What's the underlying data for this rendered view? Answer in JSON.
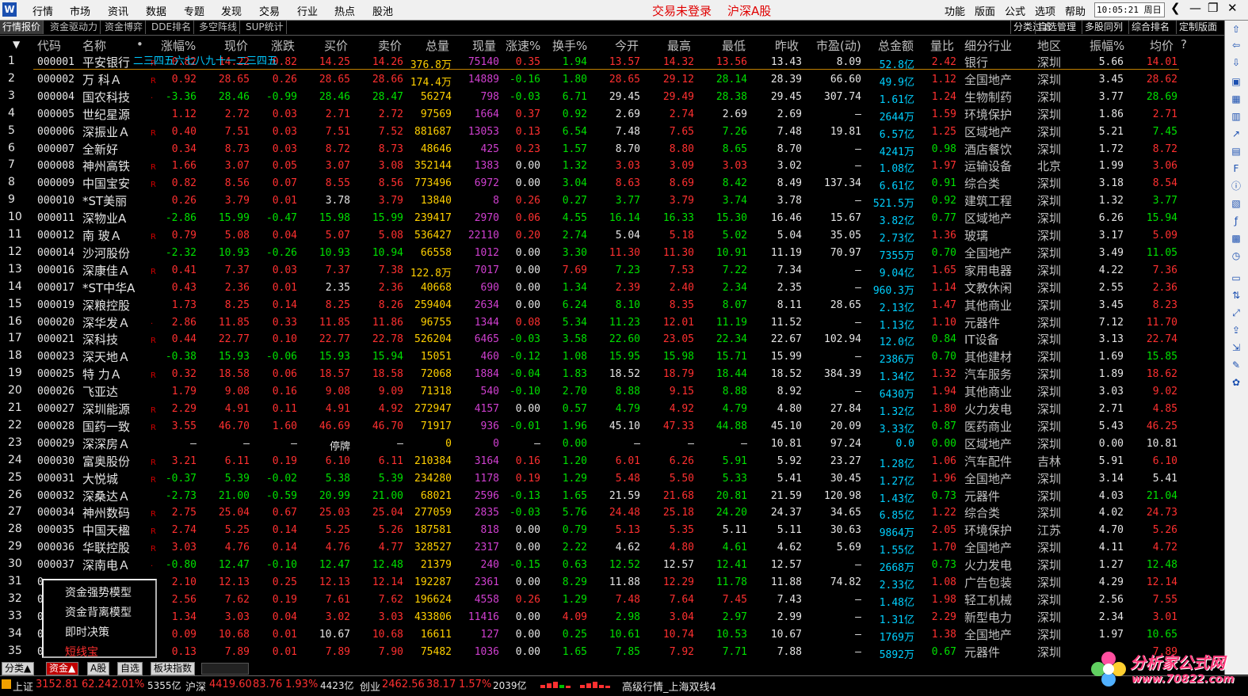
{
  "menubar": {
    "items": [
      "行情",
      "市场",
      "资讯",
      "数据",
      "专题",
      "发现",
      "交易",
      "行业",
      "热点",
      "股池"
    ],
    "status": [
      "交易未登录",
      "沪深A股"
    ],
    "right_items": [
      "功能",
      "版面",
      "公式",
      "选项",
      "帮助"
    ],
    "clock": "10:05:21 周日"
  },
  "tabs": {
    "left": [
      "行情报价",
      "资金驱动力",
      "资金博弈",
      "DDE排名",
      "多空阵线",
      "SUP统计"
    ],
    "right": [
      "分类过滤",
      "自选管理",
      "多股同列",
      "综合排名",
      "定制版面"
    ]
  },
  "table": {
    "headers": [
      "代码",
      "名称",
      "•",
      "涨幅%",
      "现价",
      "涨跌",
      "买价",
      "卖价",
      "总量",
      "现量",
      "涨速%",
      "换手%",
      "今开",
      "最高",
      "最低",
      "昨收",
      "市盈(动)",
      "总金额",
      "量比",
      "细分行业",
      "地区",
      "振幅%",
      "均价",
      "?"
    ],
    "overlay_text": "二三四五六七八九十一二三四五",
    "rows": [
      [
        "1",
        "000001",
        "平安银行",
        "R",
        "0.82",
        "14.22",
        "0.82",
        "14.25",
        "14.26",
        "376.8万",
        "75140",
        "0.35",
        "1.94",
        "13.57",
        "14.32",
        "13.56",
        "13.43",
        "8.09",
        "52.8亿",
        "2.42",
        "银行",
        "深圳",
        "5.66",
        "14.01"
      ],
      [
        "2",
        "000002",
        "万 科Ａ",
        "R",
        "0.92",
        "28.65",
        "0.26",
        "28.65",
        "28.66",
        "174.4万",
        "14889",
        "-0.16",
        "1.80",
        "28.65",
        "29.12",
        "28.14",
        "28.39",
        "66.60",
        "49.9亿",
        "1.12",
        "全国地产",
        "深圳",
        "3.45",
        "28.62"
      ],
      [
        "3",
        "000004",
        "国农科技",
        "·",
        "-3.36",
        "28.46",
        "-0.99",
        "28.46",
        "28.47",
        "56274",
        "798",
        "-0.03",
        "6.71",
        "29.45",
        "29.49",
        "28.38",
        "29.45",
        "307.74",
        "1.61亿",
        "1.24",
        "生物制药",
        "深圳",
        "3.77",
        "28.69"
      ],
      [
        "4",
        "000005",
        "世纪星源",
        "",
        "1.12",
        "2.72",
        "0.03",
        "2.71",
        "2.72",
        "97569",
        "1664",
        "0.37",
        "0.92",
        "2.69",
        "2.74",
        "2.69",
        "2.69",
        "—",
        "2644万",
        "1.59",
        "环境保护",
        "深圳",
        "1.86",
        "2.71"
      ],
      [
        "5",
        "000006",
        "深振业Ａ",
        "R",
        "0.40",
        "7.51",
        "0.03",
        "7.51",
        "7.52",
        "881687",
        "13053",
        "0.13",
        "6.54",
        "7.48",
        "7.65",
        "7.26",
        "7.48",
        "19.81",
        "6.57亿",
        "1.25",
        "区域地产",
        "深圳",
        "5.21",
        "7.45"
      ],
      [
        "6",
        "000007",
        "全新好",
        "",
        "0.34",
        "8.73",
        "0.03",
        "8.72",
        "8.73",
        "48646",
        "425",
        "0.23",
        "1.57",
        "8.70",
        "8.80",
        "8.65",
        "8.70",
        "—",
        "4241万",
        "0.98",
        "酒店餐饮",
        "深圳",
        "1.72",
        "8.72"
      ],
      [
        "7",
        "000008",
        "神州高铁",
        "R",
        "1.66",
        "3.07",
        "0.05",
        "3.07",
        "3.08",
        "352144",
        "1383",
        "0.00",
        "1.32",
        "3.03",
        "3.09",
        "3.03",
        "3.02",
        "—",
        "1.08亿",
        "1.97",
        "运输设备",
        "北京",
        "1.99",
        "3.06"
      ],
      [
        "8",
        "000009",
        "中国宝安",
        "R",
        "0.82",
        "8.56",
        "0.07",
        "8.55",
        "8.56",
        "773496",
        "6972",
        "0.00",
        "3.04",
        "8.63",
        "8.69",
        "8.42",
        "8.49",
        "137.34",
        "6.61亿",
        "0.91",
        "综合类",
        "深圳",
        "3.18",
        "8.54"
      ],
      [
        "9",
        "000010",
        "*ST美丽",
        "",
        "0.26",
        "3.79",
        "0.01",
        "3.78",
        "3.79",
        "13840",
        "8",
        "0.26",
        "0.27",
        "3.77",
        "3.79",
        "3.74",
        "3.78",
        "—",
        "521.5万",
        "0.92",
        "建筑工程",
        "深圳",
        "1.32",
        "3.77"
      ],
      [
        "10",
        "000011",
        "深物业A",
        "",
        "-2.86",
        "15.99",
        "-0.47",
        "15.98",
        "15.99",
        "239417",
        "2970",
        "0.06",
        "4.55",
        "16.14",
        "16.33",
        "15.30",
        "16.46",
        "15.67",
        "3.82亿",
        "0.77",
        "区域地产",
        "深圳",
        "6.26",
        "15.94"
      ],
      [
        "11",
        "000012",
        "南 玻Ａ",
        "R",
        "0.79",
        "5.08",
        "0.04",
        "5.07",
        "5.08",
        "536427",
        "22110",
        "0.20",
        "2.74",
        "5.04",
        "5.18",
        "5.02",
        "5.04",
        "35.05",
        "2.73亿",
        "1.36",
        "玻璃",
        "深圳",
        "3.17",
        "5.09"
      ],
      [
        "12",
        "000014",
        "沙河股份",
        "",
        "-2.32",
        "10.93",
        "-0.26",
        "10.93",
        "10.94",
        "66558",
        "1012",
        "0.00",
        "3.30",
        "11.30",
        "11.30",
        "10.91",
        "11.19",
        "70.97",
        "7355万",
        "0.70",
        "全国地产",
        "深圳",
        "3.49",
        "11.05"
      ],
      [
        "13",
        "000016",
        "深康佳Ａ",
        "R",
        "0.41",
        "7.37",
        "0.03",
        "7.37",
        "7.38",
        "122.8万",
        "7017",
        "0.00",
        "7.69",
        "7.23",
        "7.53",
        "7.22",
        "7.34",
        "—",
        "9.04亿",
        "1.65",
        "家用电器",
        "深圳",
        "4.22",
        "7.36"
      ],
      [
        "14",
        "000017",
        "*ST中华A",
        "",
        "0.43",
        "2.36",
        "0.01",
        "2.35",
        "2.36",
        "40668",
        "690",
        "0.00",
        "1.34",
        "2.39",
        "2.40",
        "2.34",
        "2.35",
        "—",
        "960.3万",
        "1.14",
        "文教休闲",
        "深圳",
        "2.55",
        "2.36"
      ],
      [
        "15",
        "000019",
        "深粮控股",
        "",
        "1.73",
        "8.25",
        "0.14",
        "8.25",
        "8.26",
        "259404",
        "2634",
        "0.00",
        "6.24",
        "8.10",
        "8.35",
        "8.07",
        "8.11",
        "28.65",
        "2.13亿",
        "1.47",
        "其他商业",
        "深圳",
        "3.45",
        "8.23"
      ],
      [
        "16",
        "000020",
        "深华发Ａ",
        "·",
        "2.86",
        "11.85",
        "0.33",
        "11.85",
        "11.86",
        "96755",
        "1344",
        "0.08",
        "5.34",
        "11.23",
        "12.01",
        "11.19",
        "11.52",
        "—",
        "1.13亿",
        "1.10",
        "元器件",
        "深圳",
        "7.12",
        "11.70"
      ],
      [
        "17",
        "000021",
        "深科技",
        "R",
        "0.44",
        "22.77",
        "0.10",
        "22.77",
        "22.78",
        "526204",
        "6465",
        "-0.03",
        "3.58",
        "22.60",
        "23.05",
        "22.34",
        "22.67",
        "102.94",
        "12.0亿",
        "0.84",
        "IT设备",
        "深圳",
        "3.13",
        "22.74"
      ],
      [
        "18",
        "000023",
        "深天地Ａ",
        "",
        "-0.38",
        "15.93",
        "-0.06",
        "15.93",
        "15.94",
        "15051",
        "460",
        "-0.12",
        "1.08",
        "15.95",
        "15.98",
        "15.71",
        "15.99",
        "—",
        "2386万",
        "0.70",
        "其他建材",
        "深圳",
        "1.69",
        "15.85"
      ],
      [
        "19",
        "000025",
        "特 力Ａ",
        "R",
        "0.32",
        "18.58",
        "0.06",
        "18.57",
        "18.58",
        "72068",
        "1884",
        "-0.04",
        "1.83",
        "18.52",
        "18.79",
        "18.44",
        "18.52",
        "384.39",
        "1.34亿",
        "1.32",
        "汽车服务",
        "深圳",
        "1.89",
        "18.62"
      ],
      [
        "20",
        "000026",
        "飞亚达",
        "",
        "1.79",
        "9.08",
        "0.16",
        "9.08",
        "9.09",
        "71318",
        "540",
        "-0.10",
        "2.70",
        "8.88",
        "9.15",
        "8.88",
        "8.92",
        "—",
        "6430万",
        "1.94",
        "其他商业",
        "深圳",
        "3.03",
        "9.02"
      ],
      [
        "21",
        "000027",
        "深圳能源",
        "R",
        "2.29",
        "4.91",
        "0.11",
        "4.91",
        "4.92",
        "272947",
        "4157",
        "0.00",
        "0.57",
        "4.79",
        "4.92",
        "4.79",
        "4.80",
        "27.84",
        "1.32亿",
        "1.80",
        "火力发电",
        "深圳",
        "2.71",
        "4.85"
      ],
      [
        "22",
        "000028",
        "国药一致",
        "R",
        "3.55",
        "46.70",
        "1.60",
        "46.69",
        "46.70",
        "71917",
        "936",
        "-0.01",
        "1.96",
        "45.10",
        "47.33",
        "44.88",
        "45.10",
        "20.09",
        "3.33亿",
        "0.87",
        "医药商业",
        "深圳",
        "5.43",
        "46.25"
      ],
      [
        "23",
        "000029",
        "深深房Ａ",
        "",
        "—",
        "—",
        "—",
        "停牌",
        "—",
        "0",
        "0",
        "—",
        "0.00",
        "—",
        "—",
        "—",
        "10.81",
        "97.24",
        "0.0",
        "0.00",
        "区域地产",
        "深圳",
        "0.00",
        "10.81"
      ],
      [
        "24",
        "000030",
        "富奥股份",
        "R",
        "3.21",
        "6.11",
        "0.19",
        "6.10",
        "6.11",
        "210384",
        "3164",
        "0.16",
        "1.20",
        "6.01",
        "6.26",
        "5.91",
        "5.92",
        "23.27",
        "1.28亿",
        "1.06",
        "汽车配件",
        "吉林",
        "5.91",
        "6.10"
      ],
      [
        "25",
        "000031",
        "大悦城",
        "R",
        "-0.37",
        "5.39",
        "-0.02",
        "5.38",
        "5.39",
        "234280",
        "1178",
        "0.19",
        "1.29",
        "5.48",
        "5.50",
        "5.33",
        "5.41",
        "30.45",
        "1.27亿",
        "1.96",
        "全国地产",
        "深圳",
        "3.14",
        "5.41"
      ],
      [
        "26",
        "000032",
        "深桑达Ａ",
        "",
        "-2.73",
        "21.00",
        "-0.59",
        "20.99",
        "21.00",
        "68021",
        "2596",
        "-0.13",
        "1.65",
        "21.59",
        "21.68",
        "20.81",
        "21.59",
        "120.98",
        "1.43亿",
        "0.73",
        "元器件",
        "深圳",
        "4.03",
        "21.04"
      ],
      [
        "27",
        "000034",
        "神州数码",
        "R",
        "2.75",
        "25.04",
        "0.67",
        "25.03",
        "25.04",
        "277059",
        "2835",
        "-0.03",
        "5.76",
        "24.48",
        "25.18",
        "24.20",
        "24.37",
        "34.65",
        "6.85亿",
        "1.22",
        "综合类",
        "深圳",
        "4.02",
        "24.73"
      ],
      [
        "28",
        "000035",
        "中国天楹",
        "R",
        "2.74",
        "5.25",
        "0.14",
        "5.25",
        "5.26",
        "187581",
        "818",
        "0.00",
        "0.79",
        "5.13",
        "5.35",
        "5.11",
        "5.11",
        "30.63",
        "9864万",
        "2.05",
        "环境保护",
        "江苏",
        "4.70",
        "5.26"
      ],
      [
        "29",
        "000036",
        "华联控股",
        "R",
        "3.03",
        "4.76",
        "0.14",
        "4.76",
        "4.77",
        "328527",
        "2317",
        "0.00",
        "2.22",
        "4.62",
        "4.80",
        "4.61",
        "4.62",
        "5.69",
        "1.55亿",
        "1.70",
        "全国地产",
        "深圳",
        "4.11",
        "4.72"
      ],
      [
        "30",
        "000037",
        "深南电Ａ",
        "·",
        "-0.80",
        "12.47",
        "-0.10",
        "12.47",
        "12.48",
        "21379",
        "240",
        "-0.15",
        "0.63",
        "12.52",
        "12.57",
        "12.41",
        "12.57",
        "—",
        "2668万",
        "0.73",
        "火力发电",
        "深圳",
        "1.27",
        "12.48"
      ],
      [
        "31",
        "0",
        "",
        "R",
        "2.10",
        "12.13",
        "0.25",
        "12.13",
        "12.14",
        "192287",
        "2361",
        "0.00",
        "8.29",
        "11.88",
        "12.29",
        "11.78",
        "11.88",
        "74.82",
        "2.33亿",
        "1.08",
        "广告包装",
        "深圳",
        "4.29",
        "12.14"
      ],
      [
        "32",
        "0",
        "",
        "R",
        "2.56",
        "7.62",
        "0.19",
        "7.61",
        "7.62",
        "196624",
        "4558",
        "0.26",
        "1.29",
        "7.48",
        "7.64",
        "7.45",
        "7.43",
        "—",
        "1.48亿",
        "1.98",
        "轻工机械",
        "深圳",
        "2.56",
        "7.55"
      ],
      [
        "33",
        "0",
        "",
        "R",
        "1.34",
        "3.03",
        "0.04",
        "3.02",
        "3.03",
        "433806",
        "11416",
        "0.00",
        "4.09",
        "2.98",
        "3.04",
        "2.97",
        "2.99",
        "—",
        "1.31亿",
        "2.29",
        "新型电力",
        "深圳",
        "2.34",
        "3.01"
      ],
      [
        "34",
        "0",
        "",
        "R",
        "0.09",
        "10.68",
        "0.01",
        "10.67",
        "10.68",
        "16611",
        "127",
        "0.00",
        "0.25",
        "10.61",
        "10.74",
        "10.53",
        "10.67",
        "—",
        "1769万",
        "1.38",
        "全国地产",
        "深圳",
        "1.97",
        "10.65"
      ],
      [
        "35",
        "0",
        "",
        "R",
        "0.13",
        "7.89",
        "0.01",
        "7.89",
        "7.90",
        "75482",
        "1036",
        "0.00",
        "1.65",
        "7.85",
        "7.92",
        "7.71",
        "7.88",
        "—",
        "5892万",
        "0.67",
        "元器件",
        "深圳",
        "",
        "7.89"
      ]
    ]
  },
  "context_menu": {
    "items": [
      "资金强势模型",
      "资金背离模型",
      "即时决策",
      "短线宝"
    ]
  },
  "bottom_tabs": [
    "分类▲",
    "资金▲",
    "A股",
    "自选",
    "板块指数"
  ],
  "statusbar": {
    "sh_label": "上证",
    "sh_index": "3152.81",
    "sh_change": "62.24",
    "sh_pct": "2.01%",
    "sh_amount": "5355亿",
    "hs_label": "沪深",
    "hs_index": "4419.60",
    "hs_change": "83.76",
    "hs_pct": "1.93%",
    "hs_amount": "4423亿",
    "cy_label": "创业",
    "cy_index": "2462.56",
    "cy_change": "38.17",
    "cy_pct": "1.57%",
    "cy_amount": "2039亿",
    "feed": "高级行情_上海双线4"
  },
  "brand": {
    "title": "分析家公式网",
    "url": "www.70822.com"
  },
  "colors": {
    "up": "#ff3030",
    "down": "#00e000",
    "flat": "#e6e6e6",
    "amount": "#00d0ff",
    "volume": "#ffd000",
    "current_volume": "#d040d0"
  }
}
